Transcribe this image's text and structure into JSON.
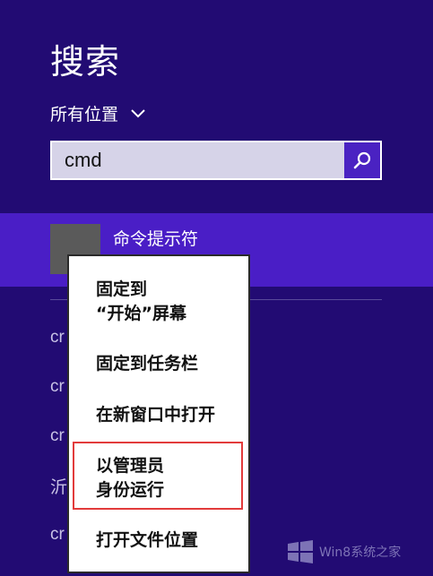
{
  "search": {
    "title": "搜索",
    "scope_label": "所有位置",
    "query_value": "cmd",
    "placeholder": ""
  },
  "result": {
    "label": "命令提示符"
  },
  "background_items": [
    {
      "text": "cr"
    },
    {
      "text": "cr"
    },
    {
      "text": "cr"
    },
    {
      "text": "沂"
    },
    {
      "text": "cr"
    }
  ],
  "context_menu": {
    "pin_start_line1": "固定到",
    "pin_start_line2": "“开始”屏幕",
    "pin_taskbar": "固定到任务栏",
    "open_new_window": "在新窗口中打开",
    "run_as_admin_line1": "以管理员",
    "run_as_admin_line2": "身份运行",
    "open_file_location": "打开文件位置"
  },
  "colors": {
    "background": "#220b73",
    "selected_row": "#4a1ec6",
    "search_button": "#4a22c2",
    "highlight_border": "#e23b3b"
  },
  "watermark": {
    "text": "Win8系统之家"
  }
}
